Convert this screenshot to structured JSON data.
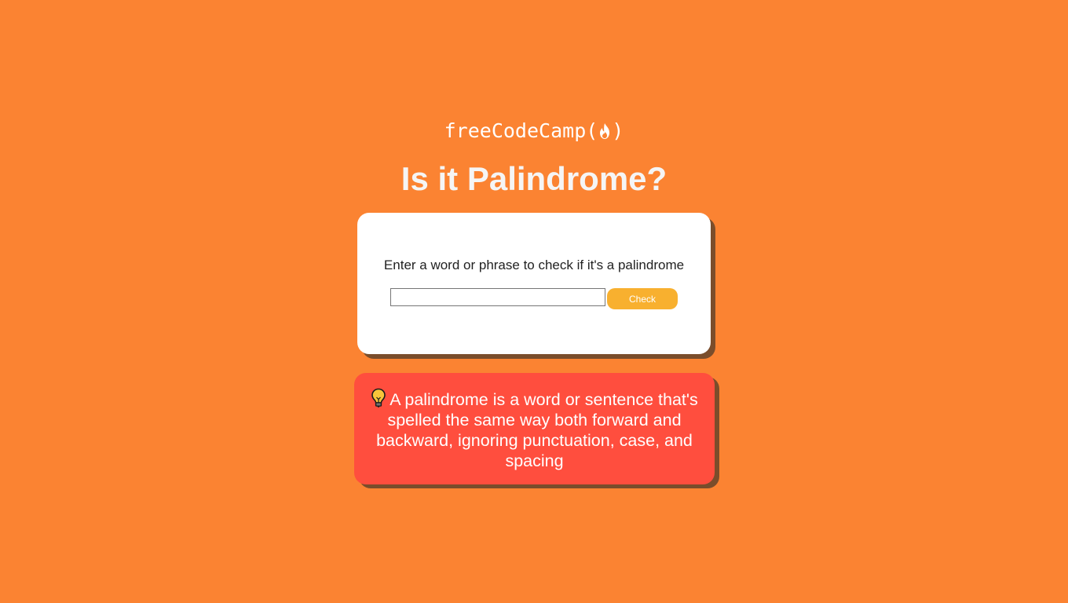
{
  "header": {
    "logo_text": "freeCodeCamp(",
    "logo_close": ")",
    "logo_icon": "flame-icon",
    "title": "Is it Palindrome?"
  },
  "checker": {
    "prompt": "Enter a word or phrase to check if it's a palindrome",
    "input_value": "",
    "input_placeholder": "",
    "button_label": "Check"
  },
  "info": {
    "icon": "lightbulb-icon",
    "text": "A palindrome is a word or sentence that's spelled the same way both forward and backward, ignoring punctuation, case, and spacing"
  },
  "colors": {
    "background": "#fb8332",
    "card": "#ffffff",
    "button": "#f8b02f",
    "info_box": "#ff4e3e",
    "shadow": "#7a4d2b"
  }
}
